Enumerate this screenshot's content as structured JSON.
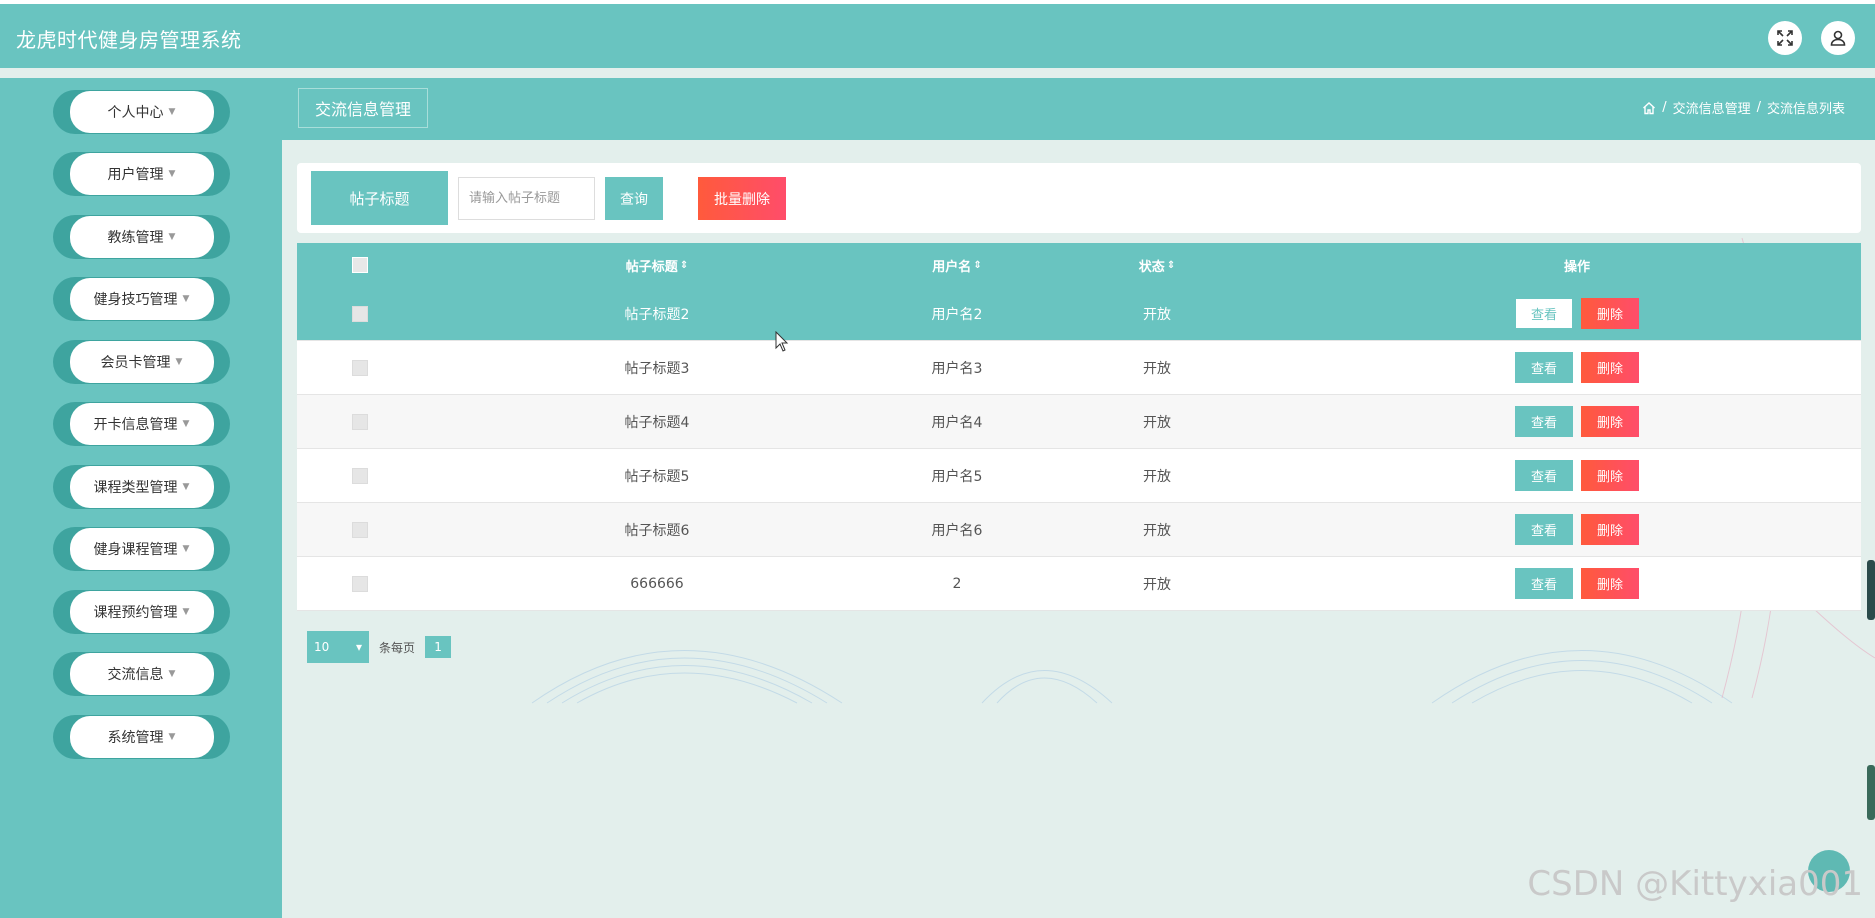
{
  "app": {
    "title": "龙虎时代健身房管理系统"
  },
  "header_icons": {
    "fullscreen": "fullscreen-icon",
    "user": "user-icon"
  },
  "sidebar": {
    "items": [
      {
        "label": "个人中心"
      },
      {
        "label": "用户管理"
      },
      {
        "label": "教练管理"
      },
      {
        "label": "健身技巧管理"
      },
      {
        "label": "会员卡管理"
      },
      {
        "label": "开卡信息管理"
      },
      {
        "label": "课程类型管理"
      },
      {
        "label": "健身课程管理"
      },
      {
        "label": "课程预约管理"
      },
      {
        "label": "交流信息"
      },
      {
        "label": "系统管理"
      }
    ]
  },
  "page": {
    "title": "交流信息管理"
  },
  "breadcrumb": {
    "items": [
      "交流信息管理",
      "交流信息列表"
    ],
    "separator": "/"
  },
  "search": {
    "label": "帖子标题",
    "placeholder": "请输入帖子标题",
    "query_label": "查询",
    "bulk_delete_label": "批量删除"
  },
  "table": {
    "headers": {
      "title": "帖子标题",
      "user": "用户名",
      "status": "状态",
      "ops": "操作",
      "sort_icon": "⇕"
    },
    "view_label": "查看",
    "delete_label": "删除",
    "rows": [
      {
        "title": "帖子标题2",
        "user": "用户名2",
        "status": "开放"
      },
      {
        "title": "帖子标题3",
        "user": "用户名3",
        "status": "开放"
      },
      {
        "title": "帖子标题4",
        "user": "用户名4",
        "status": "开放"
      },
      {
        "title": "帖子标题5",
        "user": "用户名5",
        "status": "开放"
      },
      {
        "title": "帖子标题6",
        "user": "用户名6",
        "status": "开放"
      },
      {
        "title": "666666",
        "user": "2",
        "status": "开放"
      }
    ]
  },
  "pager": {
    "page_size": "10",
    "per_page_label": "条每页",
    "current_page": "1"
  },
  "watermark": "CSDN @Kittyxia001",
  "colors": {
    "primary": "#69c4c0",
    "danger": "#ff5a3c",
    "background": "#e3efec"
  }
}
